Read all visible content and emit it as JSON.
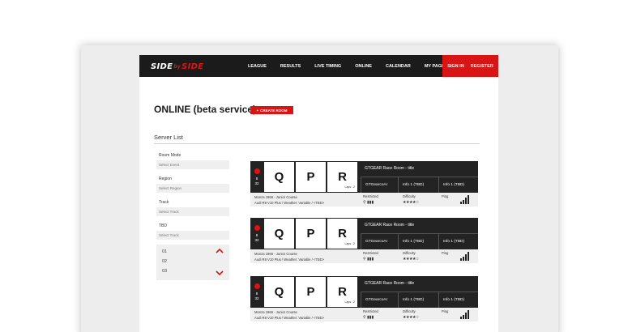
{
  "brand": {
    "logo_part1": "SIDE",
    "logo_mid": "by",
    "logo_part2": "SIDE",
    "accent_color": "#d91414"
  },
  "nav": {
    "links": [
      "LEAGUE",
      "RESULTS",
      "LIVE TIMING",
      "ONLINE",
      "CALENDAR",
      "MY PAGE"
    ],
    "signin": "SIGN IN",
    "register": "REGISTER"
  },
  "page": {
    "title": "ONLINE (beta service)",
    "create_button": "CREATE ROOM",
    "create_icon": "+",
    "section_title": "Server List"
  },
  "filters": [
    {
      "label": "Room Mode",
      "placeholder": "Select Event"
    },
    {
      "label": "Region",
      "placeholder": "Select Region"
    },
    {
      "label": "Track",
      "placeholder": "Select Track"
    },
    {
      "label": "TBD",
      "placeholder": "Select Track"
    }
  ],
  "number_list": [
    "01",
    "02",
    "03"
  ],
  "rooms": [
    {
      "count_top": "8",
      "count_bottom": "32",
      "q": "Q",
      "p": "P",
      "r": "R",
      "laps": "Laps : 2",
      "title": "GTGEAR Race Room - title",
      "host": "GTGearcoAr",
      "info1": "Info 1 (TBD)",
      "info2": "Info 1 (TBD)",
      "track_line1": "Monza 1966 - Junior Course",
      "track_line2": "Audi R8 V10 Plus / Weather: Variable / <TBD>",
      "restricted_label": "Restricted",
      "restricted_icons": "⚲ ▮▮▮",
      "difficulty_label": "Difficulty",
      "difficulty_stars": "★★★★☆",
      "ping_label": "Ping"
    },
    {
      "count_top": "8",
      "count_bottom": "32",
      "q": "Q",
      "p": "P",
      "r": "R",
      "laps": "Laps : 2",
      "title": "GTGEAR Race Room - title",
      "host": "GTGearcoAr",
      "info1": "Info 1 (TBD)",
      "info2": "Info 1 (TBD)",
      "track_line1": "Monza 1966 - Junior Course",
      "track_line2": "Audi R8 V10 Plus / Weather: Variable / <TBD>",
      "restricted_label": "Restricted",
      "restricted_icons": "⚲ ▮▮▮",
      "difficulty_label": "Difficulty",
      "difficulty_stars": "★★★★☆",
      "ping_label": "Ping"
    },
    {
      "count_top": "8",
      "count_bottom": "32",
      "q": "Q",
      "p": "P",
      "r": "R",
      "laps": "Laps : 2",
      "title": "GTGEAR Race Room - title",
      "host": "GTGearcoAr",
      "info1": "Info 1 (TBD)",
      "info2": "Info 1 (TBD)",
      "track_line1": "Monza 1966 - Junior Course",
      "track_line2": "Audi R8 V10 Plus / Weather: Variable / <TBD>",
      "restricted_label": "Restricted",
      "restricted_icons": "⚲ ▮▮▮",
      "difficulty_label": "Difficulty",
      "difficulty_stars": "★★★★☆",
      "ping_label": "Ping"
    }
  ]
}
